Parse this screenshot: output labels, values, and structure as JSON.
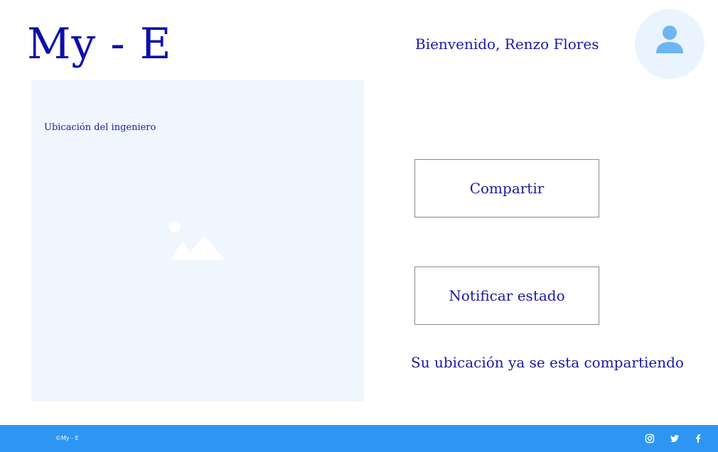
{
  "header": {
    "logo": "My - E",
    "welcome": "Bienvenido, Renzo Flores",
    "avatar_icon": "user-icon"
  },
  "map_panel": {
    "label": "Ubicación del ingeniero",
    "placeholder_icon": "image-placeholder-icon"
  },
  "actions": {
    "share_label": "Compartir",
    "notify_label": "Notificar estado"
  },
  "status": {
    "message": "Su ubicación ya se esta compartiendo"
  },
  "footer": {
    "copyright": "©My - E",
    "social_icons": [
      "instagram-icon",
      "twitter-icon",
      "facebook-icon"
    ]
  },
  "colors": {
    "primary_text": "#1a1aa6",
    "logo": "#0d0dae",
    "footer_bg": "#2d96f3",
    "panel_bg": "#eff6fe",
    "avatar_bg": "#eaf4fe",
    "avatar_icon": "#6fb4f4"
  }
}
